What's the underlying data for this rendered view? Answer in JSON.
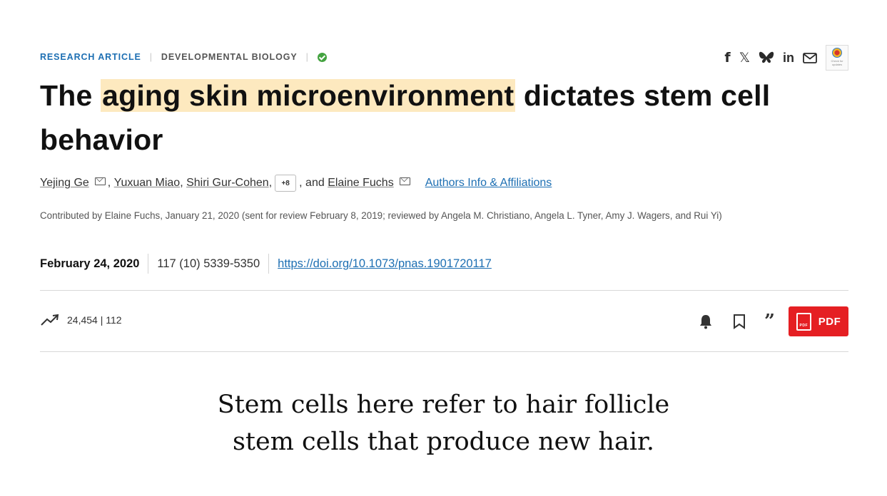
{
  "article": {
    "type_label": "RESEARCH ARTICLE",
    "subject": "DEVELOPMENTAL BIOLOGY",
    "title_prefix": "The ",
    "title_highlight": "aging skin microenvironment",
    "title_suffix": " dictates stem cell behavior",
    "authors": {
      "a1": "Yejing Ge",
      "a2": "Yuxuan Miao",
      "a3": "Shiri Gur-Cohen",
      "more": "+8",
      "and_text": ", and",
      "a4": "Elaine Fuchs",
      "info_link": "Authors Info & Affiliations"
    },
    "contributed": "Contributed by Elaine Fuchs, January 21, 2020 (sent for review February 8, 2019; reviewed by Angela M. Christiano, Angela L. Tyner, Amy J. Wagers, and Rui Yi)",
    "date": "February 24, 2020",
    "citation": "117 (10) 5339-5350",
    "doi": "https://doi.org/10.1073/pnas.1901720117",
    "views": "24,454",
    "citations": "112",
    "pdf_label": "PDF",
    "pdf_icon_text": "PDF"
  },
  "share": {
    "facebook": "f",
    "x": "𝕏",
    "linkedin": "in",
    "badge_text": "Check for updates"
  },
  "caption": {
    "line1": "Stem cells here refer to hair follicle",
    "line2": "stem cells that produce new hair."
  },
  "colors": {
    "link": "#1d6fb3",
    "highlight": "#fde9bf",
    "pdf_button": "#e51f23",
    "verified": "#44a340"
  },
  "icons": [
    "check-circle-icon",
    "facebook-icon",
    "x-icon",
    "bluesky-icon",
    "linkedin-icon",
    "email-icon",
    "trending-icon",
    "bell-icon",
    "bookmark-icon",
    "quote-icon",
    "pdf-file-icon"
  ]
}
